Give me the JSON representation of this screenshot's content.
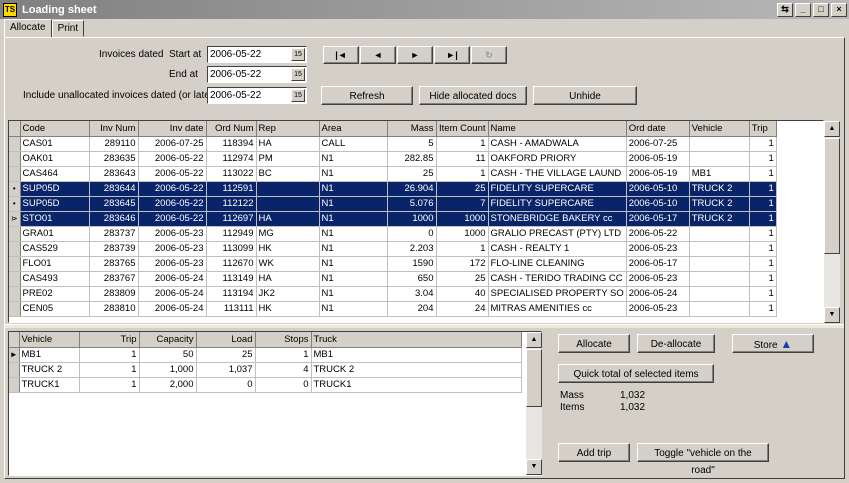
{
  "window": {
    "title": "Loading sheet",
    "app_icon": "TS",
    "controls": [
      "restore-icon",
      "minimize-icon",
      "maximize-icon",
      "close-icon"
    ]
  },
  "tabs": [
    {
      "label": "Allocate",
      "active": true
    },
    {
      "label": "Print",
      "active": false
    }
  ],
  "filters": {
    "invoices_dated_label": "Invoices dated",
    "start_at_label": "Start at",
    "start_at_value": "2006-05-22",
    "end_at_label": "End at",
    "end_at_value": "2006-05-22",
    "include_unallocated_label": "Include unallocated invoices dated (or later)",
    "include_unallocated_value": "2006-05-22"
  },
  "nav_buttons": [
    "|◄",
    "◄",
    "►",
    "►|",
    "↻"
  ],
  "buttons": {
    "refresh": "Refresh",
    "hide_allocated": "Hide allocated docs",
    "unhide": "Unhide",
    "allocate": "Allocate",
    "deallocate": "De-allocate",
    "store": "Store",
    "quick_total": "Quick total of selected items",
    "add_trip": "Add trip",
    "toggle_vehicle": "Toggle \"vehicle on the road\""
  },
  "invoices": {
    "columns": [
      "Code",
      "Inv Num",
      "Inv date",
      "Ord Num",
      "Rep",
      "Area",
      "Mass",
      "Item Count",
      "Name",
      "Ord date",
      "Vehicle",
      "Trip"
    ],
    "rows": [
      {
        "marker": "",
        "selected": false,
        "cells": [
          "CAS01",
          "289110",
          "2006-07-25",
          "118394",
          "HA",
          "CALL",
          "5",
          "1",
          "CASH - AMADWALA",
          "2006-07-25",
          "",
          "1"
        ]
      },
      {
        "marker": "",
        "selected": false,
        "cells": [
          "OAK01",
          "283635",
          "2006-05-22",
          "112974",
          "PM",
          "N1",
          "282.85",
          "11",
          "OAKFORD PRIORY",
          "2006-05-19",
          "",
          "1"
        ]
      },
      {
        "marker": "",
        "selected": false,
        "cells": [
          "CAS464",
          "283643",
          "2006-05-22",
          "113022",
          "BC",
          "N1",
          "25",
          "1",
          "CASH - THE VILLAGE LAUND",
          "2006-05-19",
          "MB1",
          "1"
        ]
      },
      {
        "marker": "•",
        "selected": true,
        "cells": [
          "SUP05D",
          "283644",
          "2006-05-22",
          "112591",
          "",
          "N1",
          "26.904",
          "25",
          "FIDELITY SUPERCARE",
          "2006-05-10",
          "TRUCK 2",
          "1"
        ]
      },
      {
        "marker": "•",
        "selected": true,
        "cells": [
          "SUP05D",
          "283645",
          "2006-05-22",
          "112122",
          "",
          "N1",
          "5.076",
          "7",
          "FIDELITY SUPERCARE",
          "2006-05-10",
          "TRUCK 2",
          "1"
        ]
      },
      {
        "marker": "⋗",
        "selected": true,
        "cells": [
          "STO01",
          "283646",
          "2006-05-22",
          "112697",
          "HA",
          "N1",
          "1000",
          "1000",
          "STONEBRIDGE BAKERY cc",
          "2006-05-17",
          "TRUCK 2",
          "1"
        ]
      },
      {
        "marker": "",
        "selected": false,
        "cells": [
          "GRA01",
          "283737",
          "2006-05-23",
          "112949",
          "MG",
          "N1",
          "0",
          "1000",
          "GRALIO PRECAST (PTY) LTD",
          "2006-05-22",
          "",
          "1"
        ]
      },
      {
        "marker": "",
        "selected": false,
        "cells": [
          "CAS529",
          "283739",
          "2006-05-23",
          "113099",
          "HK",
          "N1",
          "2.203",
          "1",
          "CASH - REALTY 1",
          "2006-05-23",
          "",
          "1"
        ]
      },
      {
        "marker": "",
        "selected": false,
        "cells": [
          "FLO01",
          "283765",
          "2006-05-23",
          "112670",
          "WK",
          "N1",
          "1590",
          "172",
          "FLO-LINE CLEANING",
          "2006-05-17",
          "",
          "1"
        ]
      },
      {
        "marker": "",
        "selected": false,
        "cells": [
          "CAS493",
          "283767",
          "2006-05-24",
          "113149",
          "HA",
          "N1",
          "650",
          "25",
          "CASH - TERIDO TRADING CC",
          "2006-05-23",
          "",
          "1"
        ]
      },
      {
        "marker": "",
        "selected": false,
        "cells": [
          "PRE02",
          "283809",
          "2006-05-24",
          "113194",
          "JK2",
          "N1",
          "3.04",
          "40",
          "SPECIALISED PROPERTY SO",
          "2006-05-24",
          "",
          "1"
        ]
      },
      {
        "marker": "",
        "selected": false,
        "cells": [
          "CEN05",
          "283810",
          "2006-05-24",
          "113111",
          "HK",
          "N1",
          "204",
          "24",
          "MITRAS AMENITIES cc",
          "2006-05-23",
          "",
          "1"
        ]
      }
    ]
  },
  "vehicles": {
    "columns": [
      "Vehicle",
      "Trip",
      "Capacity",
      "Load",
      "Stops",
      "Truck"
    ],
    "rows": [
      {
        "marker": "►",
        "cells": [
          "MB1",
          "1",
          "50",
          "25",
          "1",
          "MB1"
        ]
      },
      {
        "marker": "",
        "cells": [
          "TRUCK 2",
          "1",
          "1,000",
          "1,037",
          "4",
          "TRUCK 2"
        ]
      },
      {
        "marker": "",
        "cells": [
          "TRUCK1",
          "1",
          "2,000",
          "0",
          "0",
          "TRUCK1"
        ]
      }
    ]
  },
  "totals": {
    "mass_label": "Mass",
    "mass_value": "1,032",
    "items_label": "Items",
    "items_value": "1,032"
  },
  "colors": {
    "selection": "#0a246a",
    "face": "#d4d0c8"
  }
}
